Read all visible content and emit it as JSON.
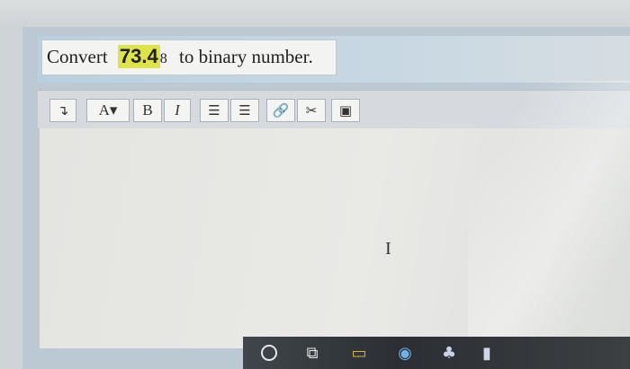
{
  "question": {
    "prefix": "Convert",
    "number": "73.4",
    "base": "8",
    "suffix": "to binary number."
  },
  "toolbar": {
    "buttons": [
      {
        "name": "paragraph-format",
        "glyph": "↴"
      },
      {
        "name": "font-color",
        "glyph": "A▾"
      },
      {
        "name": "bold",
        "glyph": "B"
      },
      {
        "name": "italic",
        "glyph": "I"
      },
      {
        "name": "bulleted-list",
        "glyph": "☰"
      },
      {
        "name": "numbered-list",
        "glyph": "☰"
      },
      {
        "name": "insert-link",
        "glyph": "🔗"
      },
      {
        "name": "remove-link",
        "glyph": "✂"
      },
      {
        "name": "insert-image",
        "glyph": "▣"
      }
    ]
  },
  "editor": {
    "cursor_glyph": "I"
  },
  "taskbar": {
    "icons": [
      {
        "name": "search-icon"
      },
      {
        "name": "task-view-icon",
        "glyph": "⧉"
      },
      {
        "name": "file-explorer-icon",
        "glyph": "▭"
      },
      {
        "name": "chrome-icon",
        "glyph": "◉"
      },
      {
        "name": "store-icon",
        "glyph": "♣"
      },
      {
        "name": "app-icon",
        "glyph": "▮"
      }
    ]
  },
  "colors": {
    "highlight": "#dfe34a",
    "toolbar_bg": "#d6dade",
    "question_bar": "#b9d0e0",
    "taskbar": "#2b2f33"
  }
}
